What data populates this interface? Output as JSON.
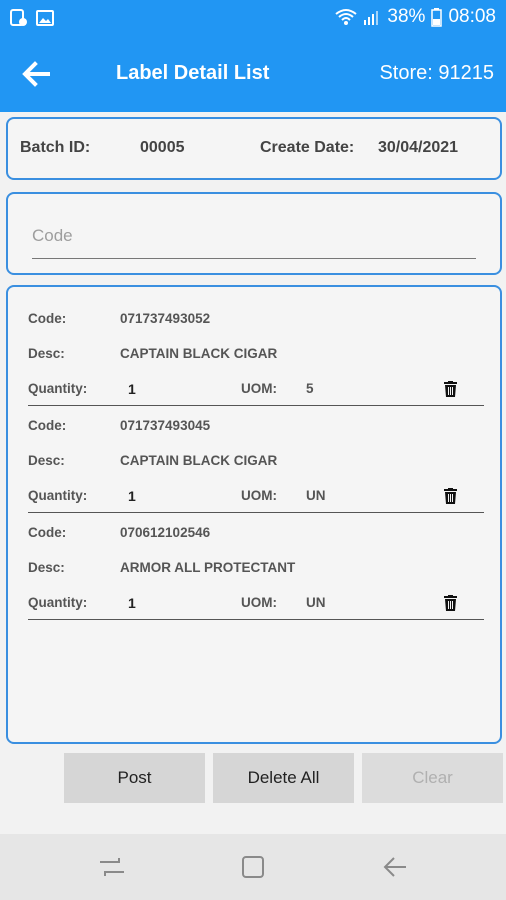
{
  "status": {
    "battery": "38%",
    "time": "08:08"
  },
  "appbar": {
    "title": "Label Detail List",
    "store": "Store: 91215"
  },
  "batch": {
    "id_label": "Batch ID:",
    "id_value": "00005",
    "date_label": "Create Date:",
    "date_value": "30/04/2021"
  },
  "code_input": {
    "placeholder": "Code"
  },
  "labels": {
    "code": "Code:",
    "desc": "Desc:",
    "quantity": "Quantity:",
    "uom": "UOM:"
  },
  "items": [
    {
      "code": "071737493052",
      "desc": "CAPTAIN BLACK CIGAR",
      "quantity": "1",
      "uom": "5"
    },
    {
      "code": "071737493045",
      "desc": "CAPTAIN BLACK CIGAR",
      "quantity": "1",
      "uom": "UN"
    },
    {
      "code": "070612102546",
      "desc": "ARMOR ALL PROTECTANT",
      "quantity": "1",
      "uom": "UN"
    }
  ],
  "buttons": {
    "post": "Post",
    "delete_all": "Delete All",
    "clear": "Clear"
  },
  "colors": {
    "accent": "#2196f3",
    "border": "#3a8fe0"
  }
}
